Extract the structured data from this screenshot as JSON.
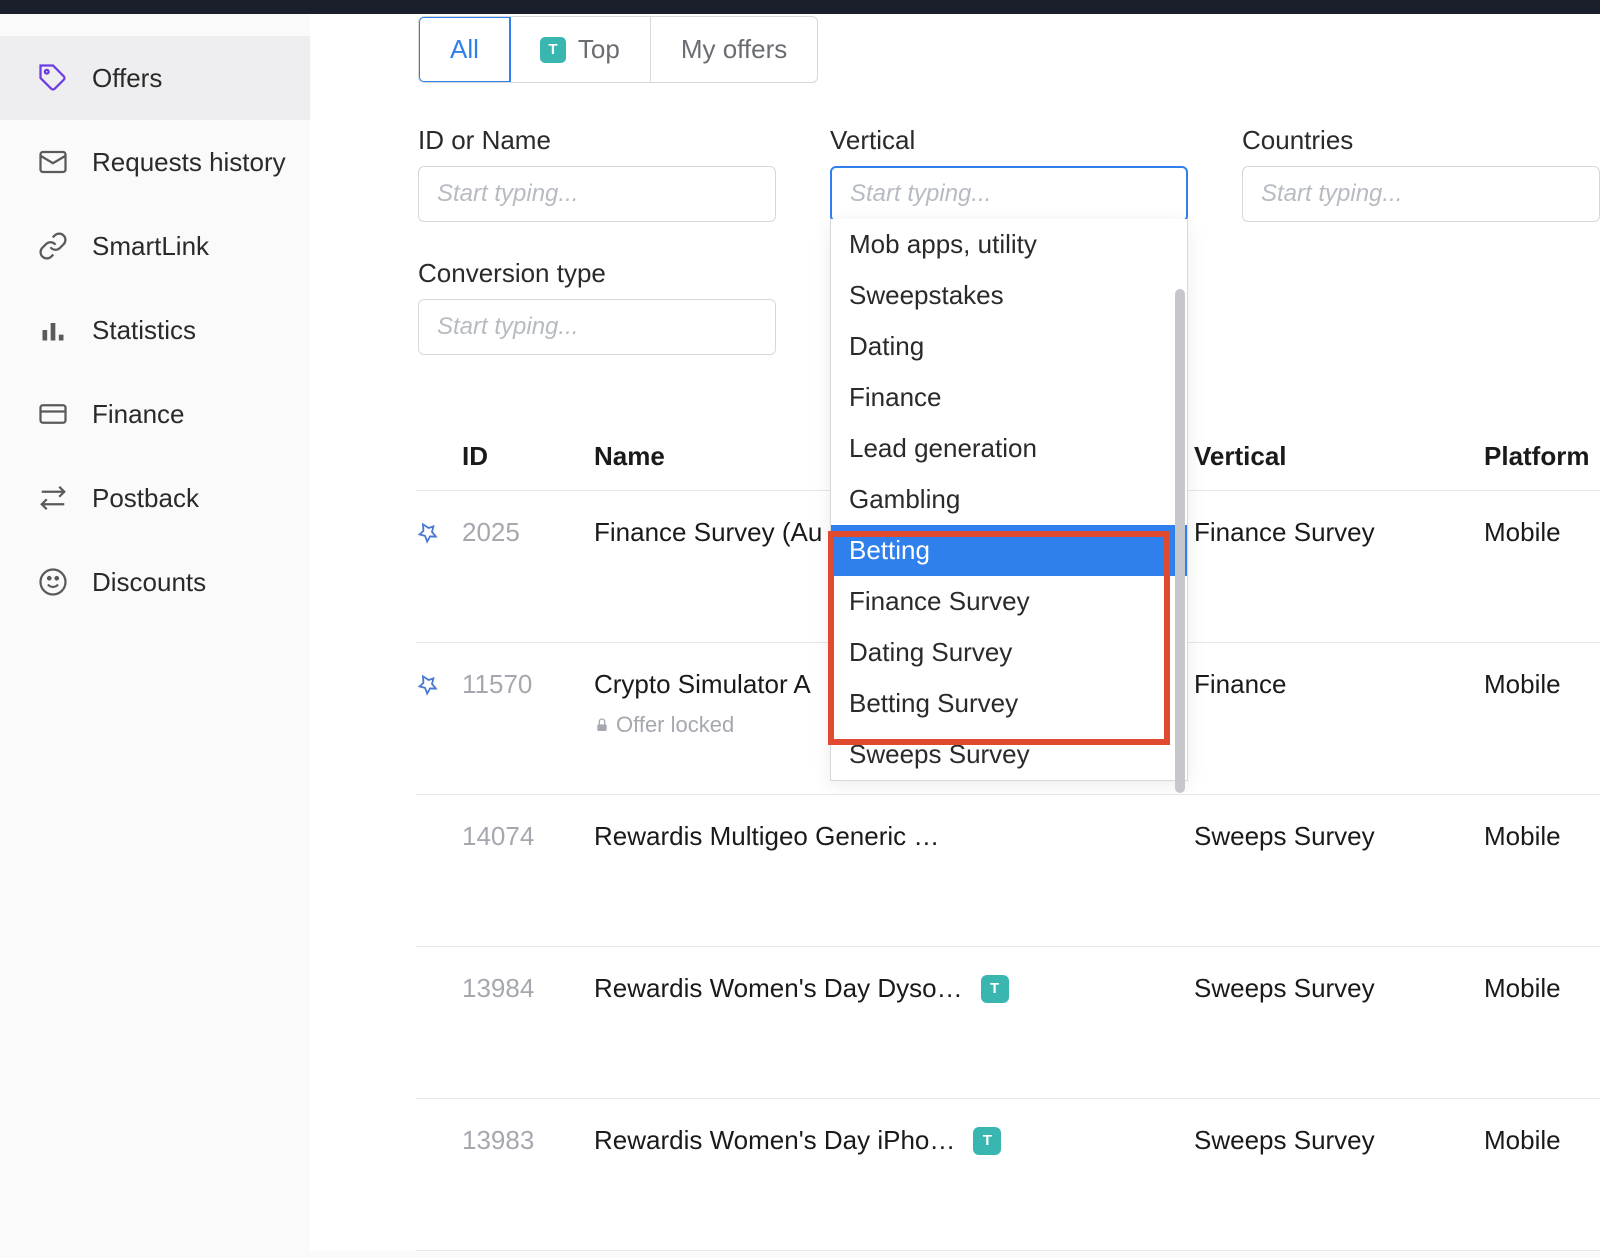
{
  "sidebar": {
    "items": [
      {
        "label": "Offers",
        "icon": "tag-icon",
        "active": true
      },
      {
        "label": "Requests history",
        "icon": "mail-icon",
        "active": false
      },
      {
        "label": "SmartLink",
        "icon": "link-icon",
        "active": false
      },
      {
        "label": "Statistics",
        "icon": "stats-icon",
        "active": false
      },
      {
        "label": "Finance",
        "icon": "card-icon",
        "active": false
      },
      {
        "label": "Postback",
        "icon": "swap-icon",
        "active": false
      },
      {
        "label": "Discounts",
        "icon": "smile-icon",
        "active": false
      }
    ]
  },
  "tabs": {
    "all": "All",
    "top": "Top",
    "top_badge": "T",
    "my": "My offers"
  },
  "filters": {
    "id_label": "ID or Name",
    "id_placeholder": "Start typing...",
    "vertical_label": "Vertical",
    "vertical_placeholder": "Start typing...",
    "countries_label": "Countries",
    "countries_placeholder": "Start typing...",
    "conversion_label": "Conversion type",
    "conversion_placeholder": "Start typing..."
  },
  "vertical_dropdown": {
    "options": [
      "Mob apps, utility",
      "Sweepstakes",
      "Dating",
      "Finance",
      "Lead generation",
      "Gambling",
      "Betting",
      "Finance Survey",
      "Dating Survey",
      "Betting Survey",
      "Sweeps Survey"
    ],
    "selected": "Betting"
  },
  "table": {
    "headers": {
      "id": "ID",
      "name": "Name",
      "vertical": "Vertical",
      "platform": "Platform"
    },
    "locked_text": "Offer locked",
    "rows": [
      {
        "pinned": true,
        "id": "2025",
        "name": "Finance Survey (Au",
        "badge": false,
        "locked": false,
        "vertical": "Finance Survey",
        "platform": "Mobile"
      },
      {
        "pinned": true,
        "id": "11570",
        "name": "Crypto Simulator A",
        "badge": false,
        "locked": true,
        "vertical": "Finance",
        "platform": "Mobile"
      },
      {
        "pinned": false,
        "id": "14074",
        "name": "Rewardis Multigeo Generic …",
        "badge": false,
        "locked": false,
        "vertical": "Sweeps Survey",
        "platform": "Mobile"
      },
      {
        "pinned": false,
        "id": "13984",
        "name": "Rewardis Women's Day Dyso…",
        "badge": true,
        "badge_text": "T",
        "locked": false,
        "vertical": "Sweeps Survey",
        "platform": "Mobile"
      },
      {
        "pinned": false,
        "id": "13983",
        "name": "Rewardis Women's Day iPho…",
        "badge": true,
        "badge_text": "T",
        "locked": false,
        "vertical": "Sweeps Survey",
        "platform": "Mobile"
      }
    ]
  }
}
